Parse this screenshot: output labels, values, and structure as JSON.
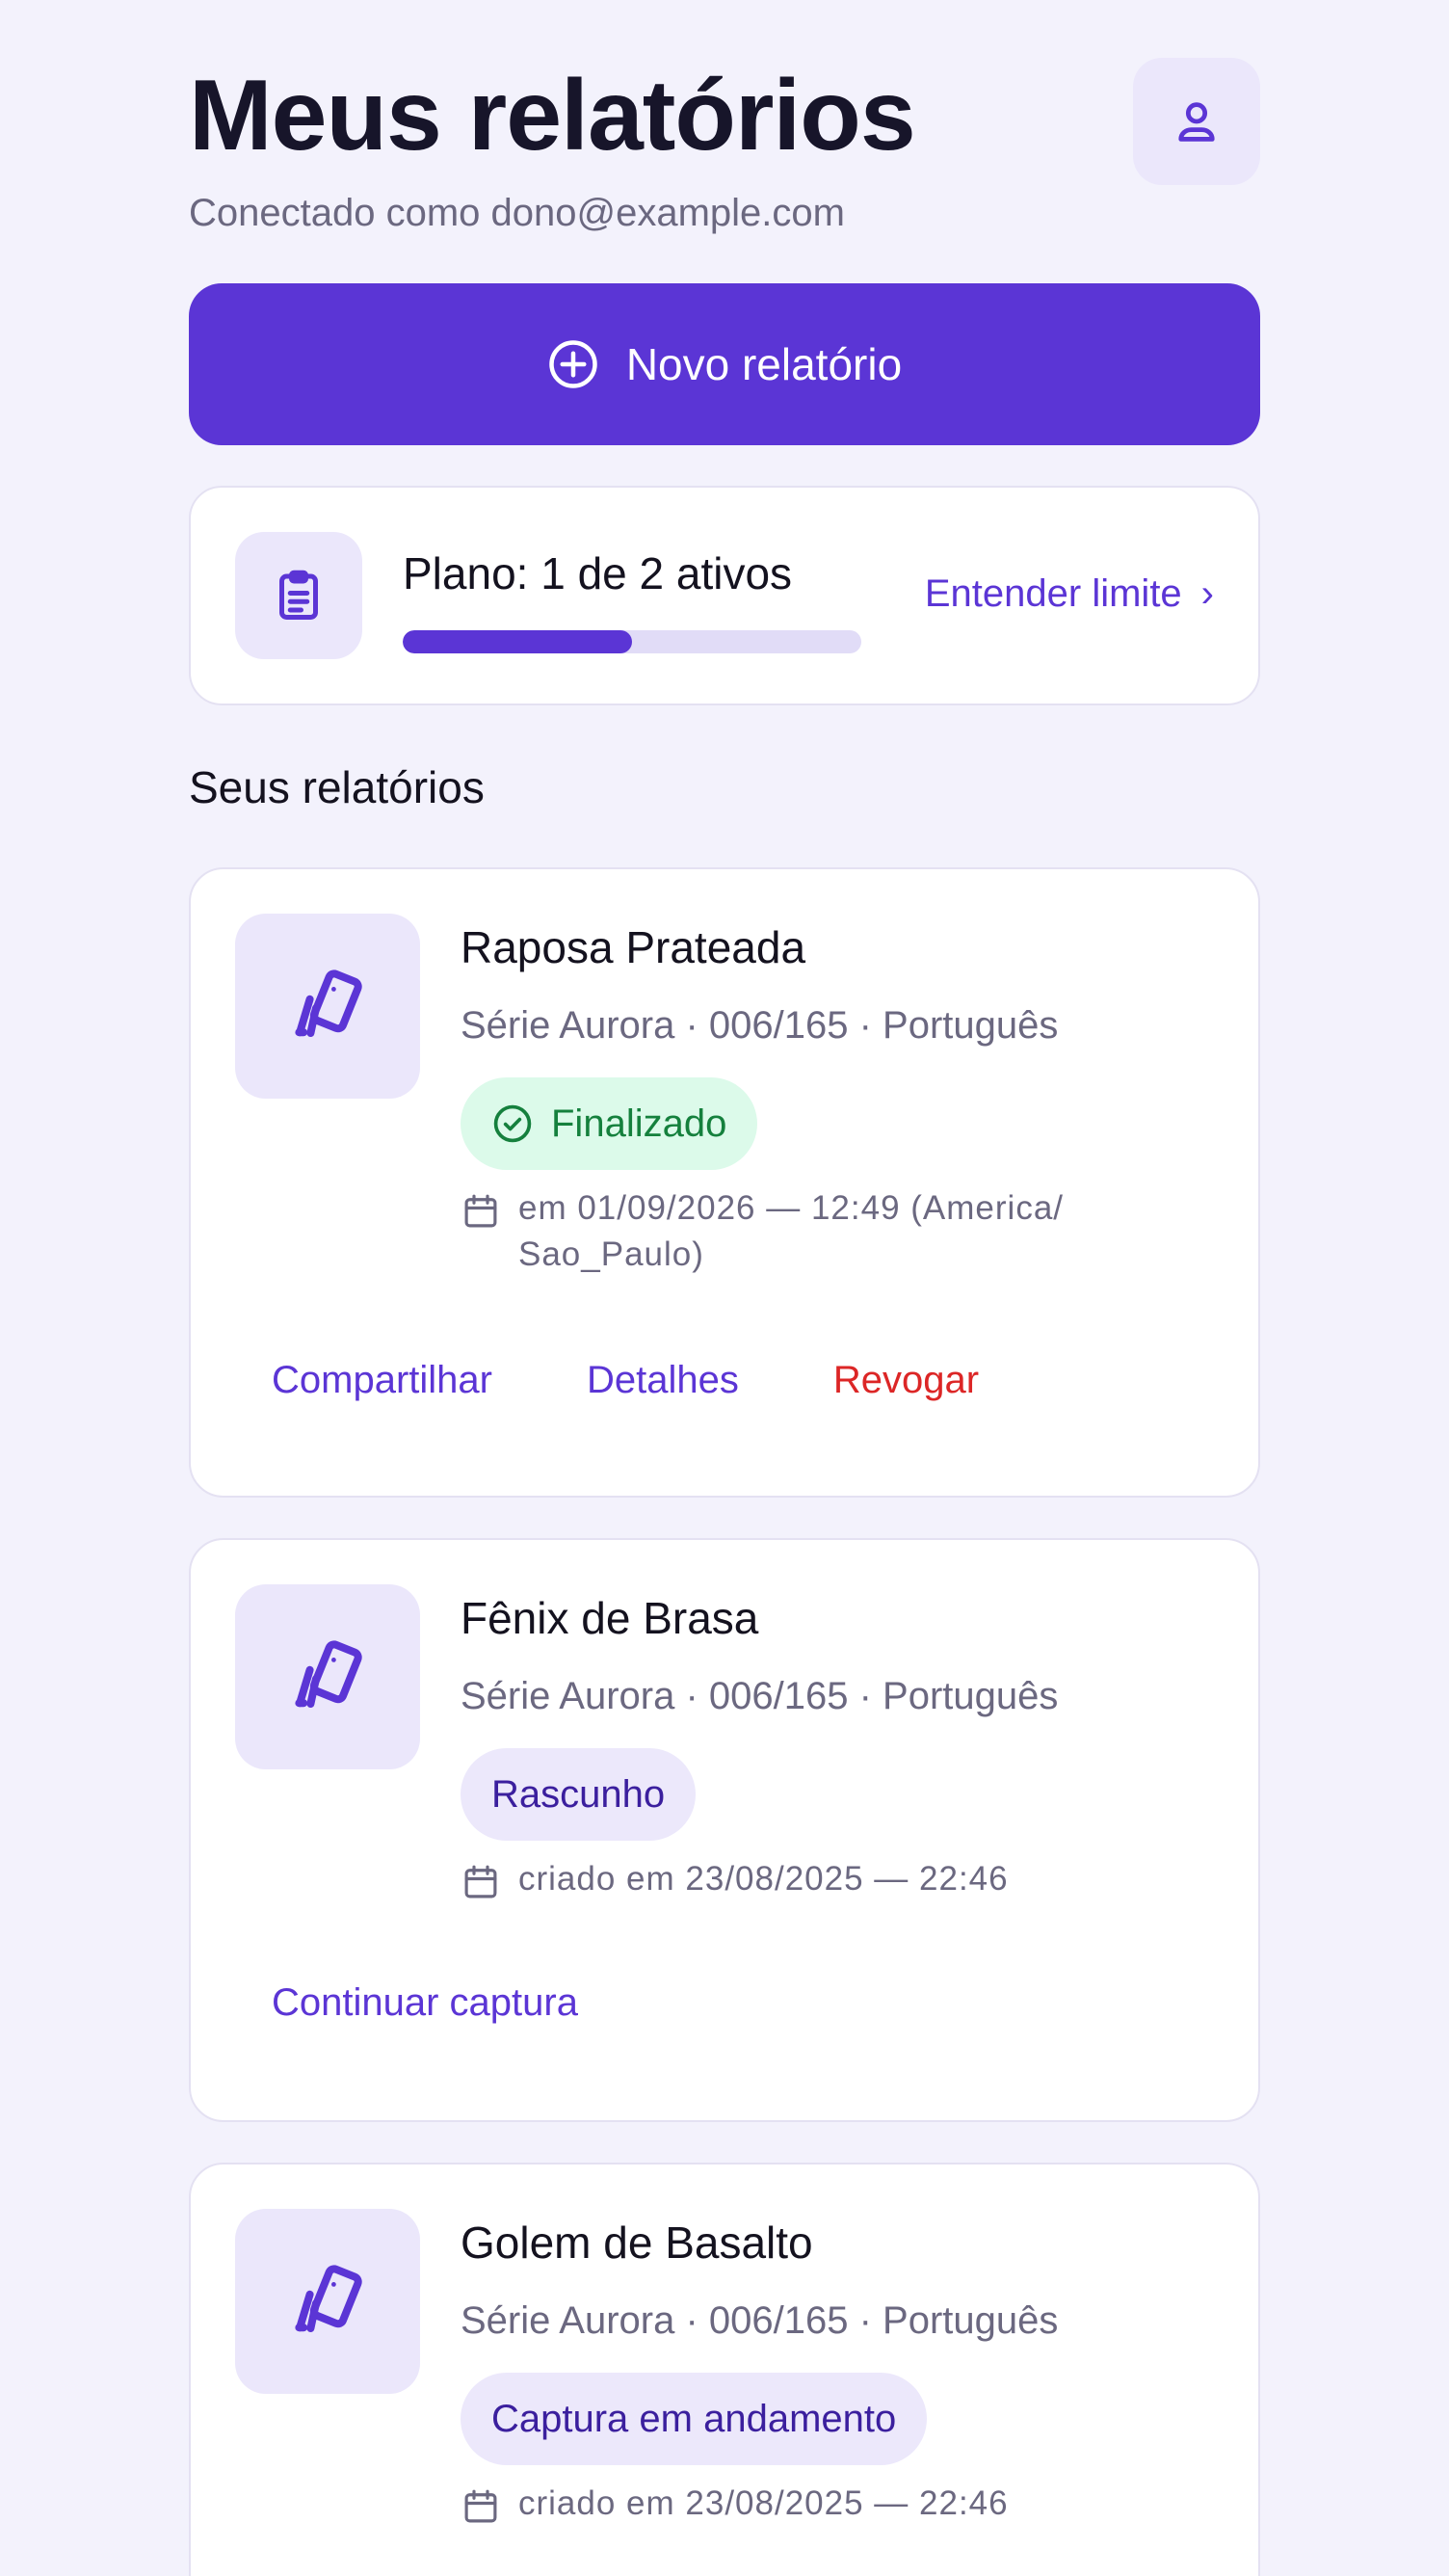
{
  "header": {
    "title": "Meus relatórios",
    "subtitle": "Conectado como dono@example.com",
    "profile_icon": "user-icon"
  },
  "new_report_button": {
    "label": "Novo relatório",
    "icon": "plus-circle-icon"
  },
  "plan": {
    "label": "Plano: 1 de 2 ativos",
    "used": 1,
    "total": 2,
    "progress_fraction": 0.5,
    "link_label": "Entender limite",
    "link_chevron": "›",
    "icon": "clipboard-icon"
  },
  "section_title": "Seus relatórios",
  "reports": [
    {
      "title": "Raposa Prateada",
      "meta": "Série Aurora · 006/165 · Português",
      "status": "Finalizado",
      "status_icon": "check-circle-icon",
      "date": "em 01/09/2026 — 12:49 (America/ Sao_Paulo)",
      "actions": [
        "Compartilhar",
        "Detalhes",
        "Revogar"
      ]
    },
    {
      "title": "Fênix de Brasa",
      "meta": "Série Aurora · 006/165 · Português",
      "status": "Rascunho",
      "date": "criado em 23/08/2025 — 22:46",
      "actions": [
        "Continuar captura"
      ]
    },
    {
      "title": "Golem de Basalto",
      "meta": "Série Aurora · 006/165 · Português",
      "status": "Captura em andamento",
      "date": "criado em 23/08/2025 — 22:46",
      "actions": []
    }
  ],
  "colors": {
    "accent": "#5b35d5",
    "background": "#f3f2fc",
    "success_bg": "#dcfaea",
    "success_text": "#15803d",
    "danger": "#dc2626"
  }
}
